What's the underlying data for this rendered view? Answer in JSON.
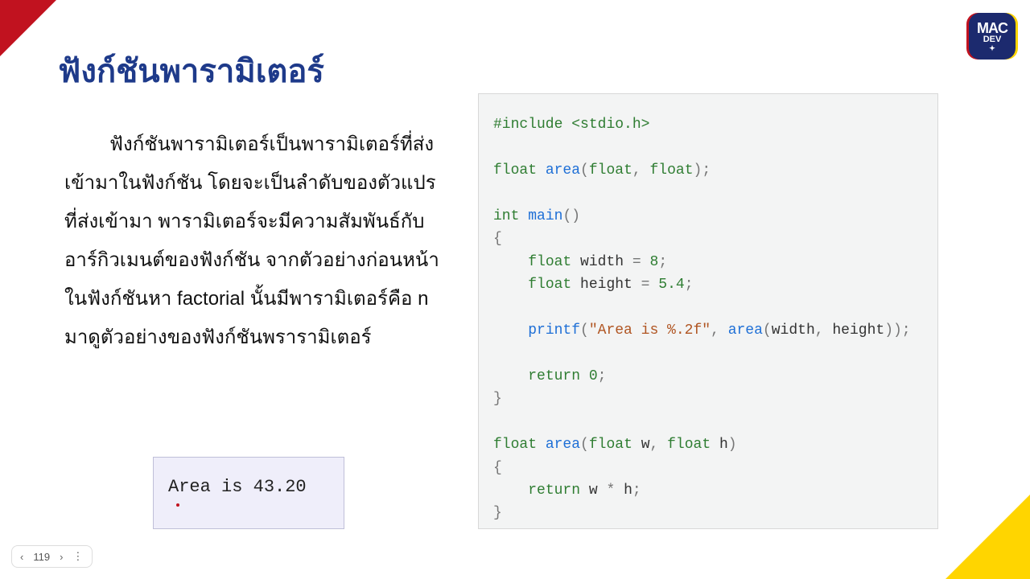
{
  "logo": {
    "l1": "MAC",
    "l2": "DEV",
    "l3": "✦"
  },
  "title": "ฟังก์ชันพารามิเตอร์",
  "body": "ฟังก์ชันพารามิเตอร์เป็นพารามิเตอร์ที่ส่งเข้ามาในฟังก์ชัน โดยจะเป็นลำดับของตัวแปรที่ส่งเข้ามา พารามิเตอร์จะมีความสัมพันธ์กับอาร์กิวเมนต์ของฟังก์ชัน จากตัวอย่างก่อนหน้า ในฟังก์ชันหา factorial นั้นมีพารามิเตอร์คือ n มาดูตัวอย่างของฟังก์ชันพรารามิเตอร์",
  "output": "Area is 43.20",
  "code": {
    "include": "#include",
    "stdio": "<stdio.h>",
    "float": "float",
    "int": "int",
    "return": "return",
    "area": "area",
    "main": "main",
    "printf": "printf",
    "width": "width",
    "height": "height",
    "w": "w",
    "h": "h",
    "eight": "8",
    "fivefour": "5.4",
    "zero": "0",
    "fmt": "\"Area is %.2f\""
  },
  "pager": {
    "page": "119"
  }
}
